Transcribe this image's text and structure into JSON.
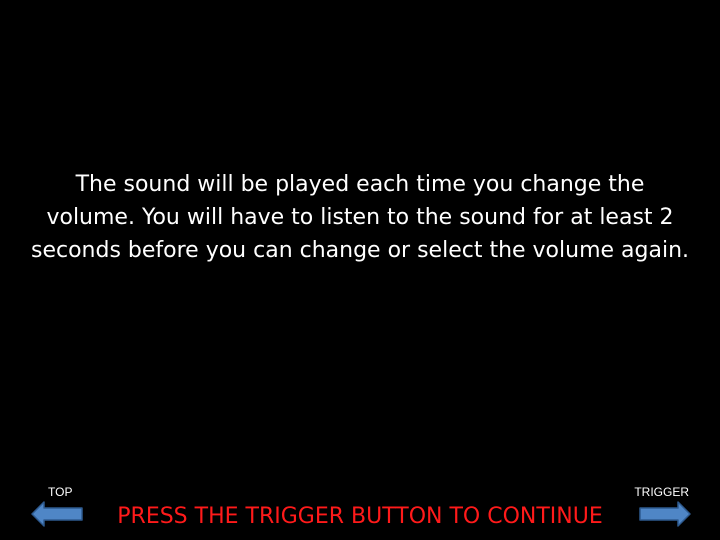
{
  "instructions": {
    "text": "The sound will be played each time you change the volume. You will have to listen to the sound for at least 2 seconds before you can change or select the volume again."
  },
  "nav": {
    "top_label": "TOP",
    "trigger_label": "TRIGGER",
    "left_arrow_icon": "arrow-left-icon",
    "right_arrow_icon": "arrow-right-icon"
  },
  "prompt": {
    "text": "PRESS THE TRIGGER BUTTON TO CONTINUE"
  },
  "colors": {
    "background": "#000000",
    "text": "#ffffff",
    "prompt": "#ff1a1a",
    "arrow_fill": "#4f86c6",
    "arrow_stroke": "#2e5a8f"
  }
}
